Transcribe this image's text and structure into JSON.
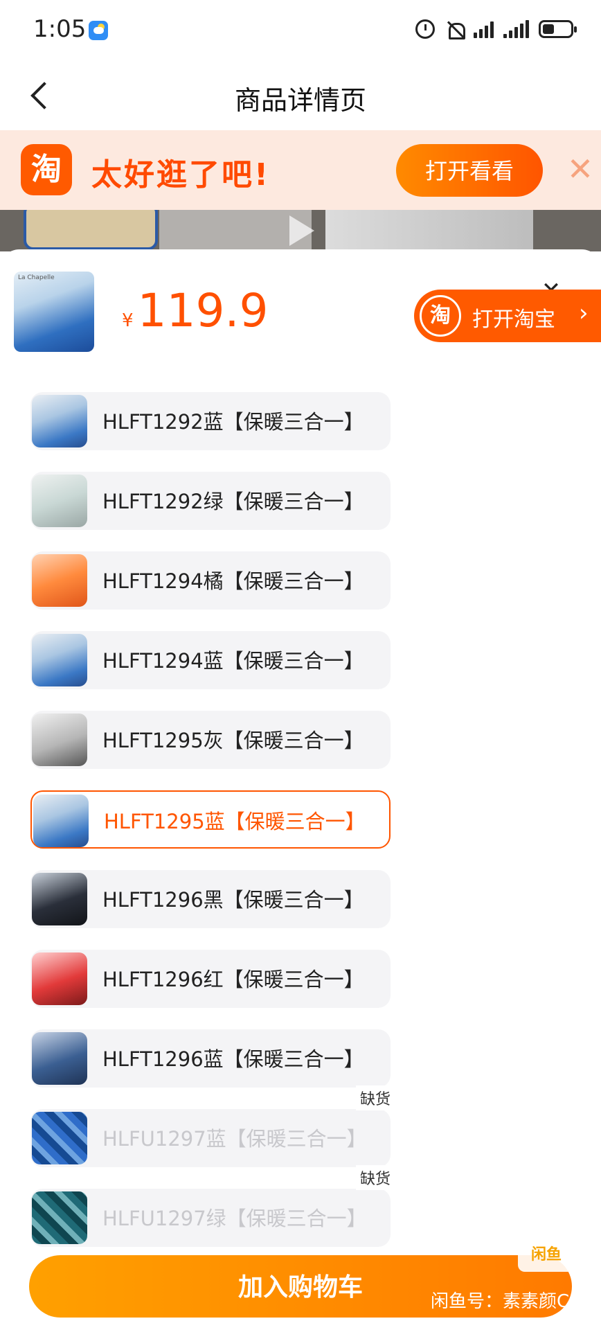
{
  "status_bar": {
    "time": "1:05"
  },
  "nav": {
    "title": "商品详情页"
  },
  "promo": {
    "logo_text": "淘",
    "slogan": "太好逛了吧!",
    "button": "打开看看",
    "close": "✕"
  },
  "sheet": {
    "currency": "¥",
    "price": "119.9",
    "close": "✕",
    "open_taobao": {
      "logo_text": "淘",
      "label": "打开淘宝",
      "chevron": "›"
    }
  },
  "options": [
    {
      "label": "HLFT1292蓝【保暖三合一】",
      "thumb": "th-blue"
    },
    {
      "label": "HLFT1292绿【保暖三合一】",
      "thumb": "th-green"
    },
    {
      "label": "HLFT1294橘【保暖三合一】",
      "thumb": "th-orange"
    },
    {
      "label": "HLFT1294蓝【保暖三合一】",
      "thumb": "th-blue"
    },
    {
      "label": "HLFT1295灰【保暖三合一】",
      "thumb": "th-gray"
    },
    {
      "label": "HLFT1295蓝【保暖三合一】",
      "thumb": "th-blue",
      "selected": true
    },
    {
      "label": "HLFT1296黑【保暖三合一】",
      "thumb": "th-black"
    },
    {
      "label": "HLFT1296红【保暖三合一】",
      "thumb": "th-red"
    },
    {
      "label": "HLFT1296蓝【保暖三合一】",
      "thumb": "th-navy"
    },
    {
      "label": "HLFU1297蓝【保暖三合一】",
      "thumb": "th-camo-blue",
      "disabled": true,
      "badge": "缺货"
    },
    {
      "label": "HLFU1297绿【保暖三合一】",
      "thumb": "th-camo-green",
      "disabled": true,
      "badge": "缺货"
    }
  ],
  "add_to_cart": "加入购物车",
  "watermark": {
    "logo": "闲鱼",
    "text": "闲鱼号：素素颜C"
  },
  "colors": {
    "accent": "#ff5500",
    "cart": "#ff8c00",
    "promo_bg": "#fde9df"
  }
}
